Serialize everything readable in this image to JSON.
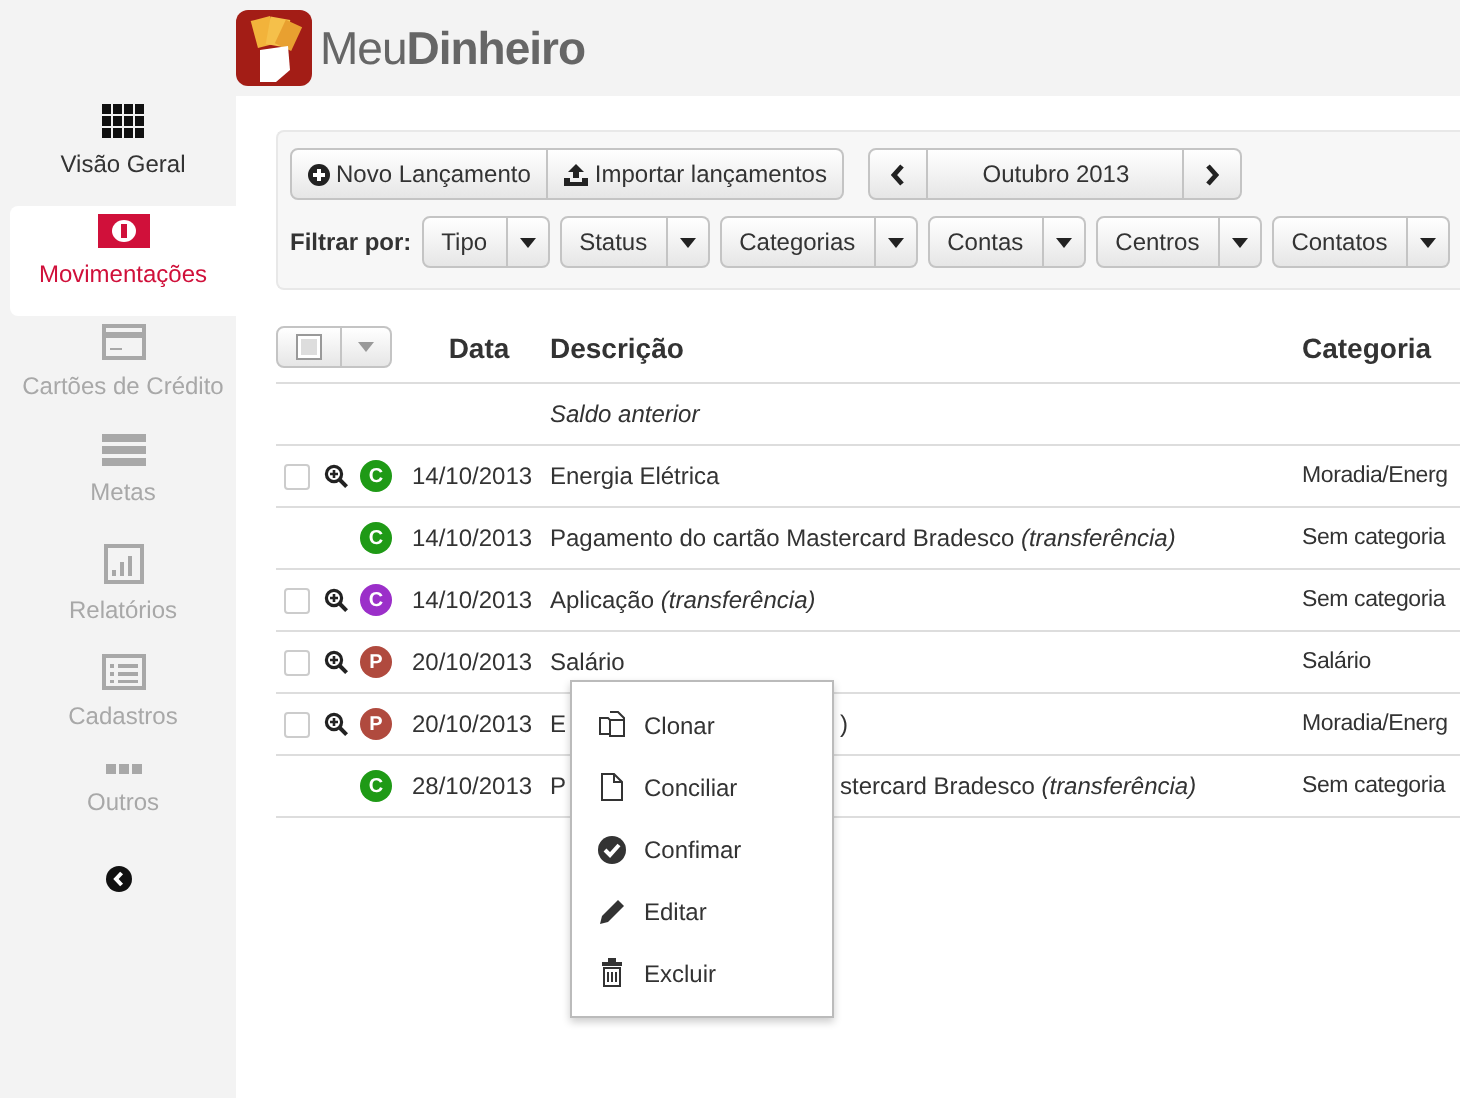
{
  "logo": {
    "text": "Meu**Dinheiro**"
  },
  "sidebar": {
    "items": [
      {
        "label": "Visão Geral",
        "selected": false,
        "disabled": false
      },
      {
        "label": "Movimentações",
        "selected": true,
        "disabled": false
      },
      {
        "label": "Cartões de Crédito",
        "selected": false,
        "disabled": true
      },
      {
        "label": "Metas",
        "selected": false,
        "disabled": true
      },
      {
        "label": "Relatórios",
        "selected": false,
        "disabled": true
      },
      {
        "label": "Cadastros",
        "selected": false,
        "disabled": true
      },
      {
        "label": "Outros",
        "selected": false,
        "disabled": true
      }
    ]
  },
  "toolbar": {
    "buttons": [
      "Novo Lançamento",
      "Importar lançamentos"
    ],
    "month": "Outubro 2013",
    "filter_label": "Filtrar por:",
    "filters": [
      "Tipo",
      "Status",
      "Categorias",
      "Contas",
      "Centros",
      "Contatos"
    ]
  },
  "table": {
    "select_all": {
      "checked": false
    },
    "columns": [
      "Data",
      "Descrição",
      "Categoria"
    ],
    "opening_row": "Saldo anterior",
    "rows": [
      {
        "selectable": true,
        "checked": false,
        "badge": "C",
        "color": "#1f9a16",
        "date": "14/10/2013",
        "description": "Energia Elétrica",
        "category": "Moradia/Energ"
      },
      {
        "selectable": false,
        "badge": "C",
        "color": "#1f9a16",
        "date": "14/10/2013",
        "description": "Pagamento do cartão Mastercard Bradesco *(transferência)*",
        "category": "Sem categoria"
      },
      {
        "selectable": true,
        "checked": false,
        "badge": "C",
        "color": "#9b2fc9",
        "date": "14/10/2013",
        "description": "Aplicação *(transferência)*",
        "category": "Sem categoria"
      },
      {
        "selectable": true,
        "checked": false,
        "badge": "P",
        "color": "#b04a3e",
        "date": "20/10/2013",
        "description": "Salário",
        "category": "Salário"
      },
      {
        "selectable": true,
        "checked": false,
        "badge": "P",
        "color": "#b04a3e",
        "date": "20/10/2013",
        "description": "E",
        "description_end": ")",
        "category": "Moradia/Energ"
      },
      {
        "selectable": false,
        "badge": "C",
        "color": "#1f9a16",
        "date": "28/10/2013",
        "description": "P",
        "description_end": "stercard Bradesco *(transferência)*",
        "category": "Sem categoria"
      }
    ]
  },
  "context_menu": {
    "items": [
      "Clonar",
      "Conciliar",
      "Confimar",
      "Editar",
      "Excluir"
    ]
  }
}
